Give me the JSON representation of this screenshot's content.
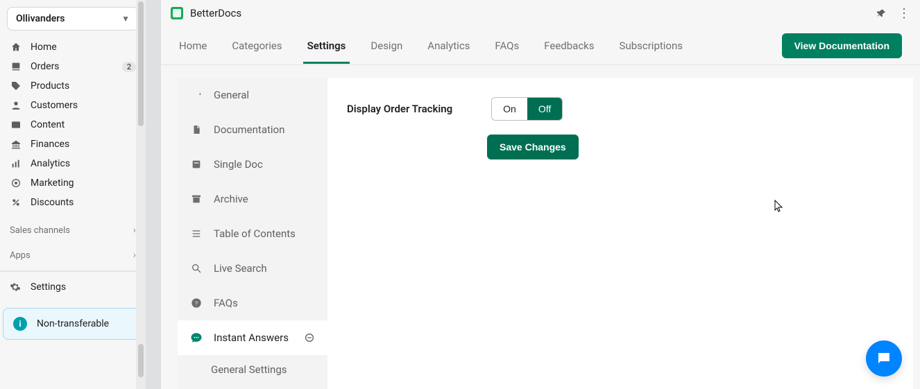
{
  "store": {
    "name": "Ollivanders"
  },
  "nav": {
    "home": "Home",
    "orders": "Orders",
    "orders_badge": "2",
    "products": "Products",
    "customers": "Customers",
    "content": "Content",
    "finances": "Finances",
    "analytics": "Analytics",
    "marketing": "Marketing",
    "discounts": "Discounts",
    "sales_channels": "Sales channels",
    "apps": "Apps",
    "settings": "Settings"
  },
  "notice": {
    "text": "Non-transferable"
  },
  "app": {
    "title": "BetterDocs"
  },
  "tabs": {
    "home": "Home",
    "categories": "Categories",
    "settings": "Settings",
    "design": "Design",
    "analytics": "Analytics",
    "faqs": "FAQs",
    "feedbacks": "Feedbacks",
    "subscriptions": "Subscriptions",
    "view_doc": "View Documentation"
  },
  "settings_side": {
    "general": "General",
    "documentation": "Documentation",
    "single_doc": "Single Doc",
    "archive": "Archive",
    "toc": "Table of Contents",
    "live_search": "Live Search",
    "faqs": "FAQs",
    "instant_answers": "Instant Answers",
    "general_settings": "General Settings"
  },
  "panel": {
    "display_order_tracking": "Display Order Tracking",
    "on": "On",
    "off": "Off",
    "save": "Save Changes"
  }
}
